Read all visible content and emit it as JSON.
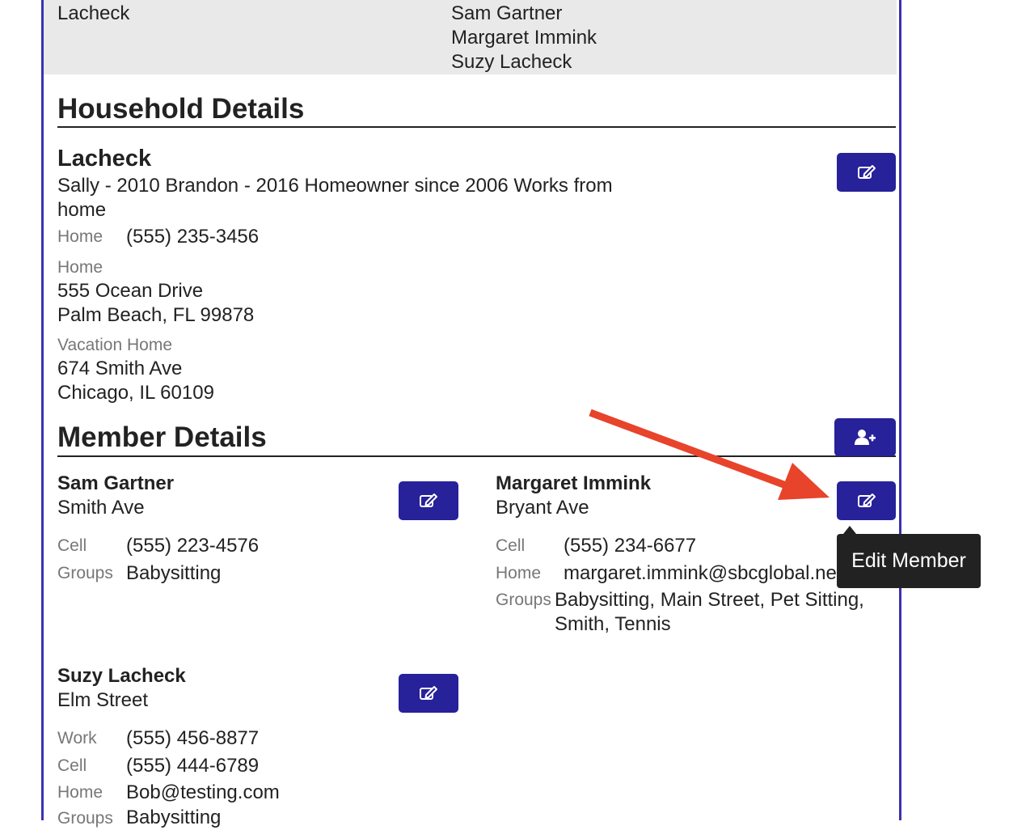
{
  "top": {
    "left_name": "Lacheck",
    "members": [
      "Sam Gartner",
      "Margaret Immink",
      "Suzy Lacheck"
    ]
  },
  "household": {
    "section_title": "Household Details",
    "name": "Lacheck",
    "notes_line1": "Sally - 2010 Brandon - 2016 Homeowner since 2006 Works from",
    "notes_line2": "home",
    "phone_label": "Home",
    "phone": "(555) 235-3456",
    "addresses": [
      {
        "label": "Home",
        "line1": "555 Ocean Drive",
        "line2": "Palm Beach, FL 99878"
      },
      {
        "label": "Vacation Home",
        "line1": "674 Smith Ave",
        "line2": "Chicago, IL 60109"
      }
    ],
    "edit_icon": "edit-icon"
  },
  "members_section": {
    "title": "Member Details",
    "add_icon": "add-user-icon",
    "members": [
      {
        "name": "Sam Gartner",
        "street": "Smith Ave",
        "rows": [
          {
            "label": "Cell",
            "value": "(555) 223-4576"
          },
          {
            "label": "Groups",
            "value": "Babysitting"
          }
        ]
      },
      {
        "name": "Margaret Immink",
        "street": "Bryant Ave",
        "rows": [
          {
            "label": "Cell",
            "value": "(555) 234-6677"
          },
          {
            "label": "Home",
            "value": "margaret.immink@sbcglobal.ne"
          },
          {
            "label": "Groups",
            "value": "Babysitting, Main Street, Pet Sitting,",
            "value2": "Smith, Tennis"
          }
        ]
      },
      {
        "name": "Suzy Lacheck",
        "street": "Elm Street",
        "rows": [
          {
            "label": "Work",
            "value": "(555) 456-8877"
          },
          {
            "label": "Cell",
            "value": "(555) 444-6789"
          },
          {
            "label": "Home",
            "value": "Bob@testing.com"
          },
          {
            "label": "Groups",
            "value": "Babysitting"
          }
        ]
      }
    ]
  },
  "tooltip": {
    "text": "Edit Member"
  },
  "colors": {
    "button": "#27219a",
    "frame": "#3a32b0",
    "arrow": "#e8432b",
    "tooltip": "#222222"
  }
}
